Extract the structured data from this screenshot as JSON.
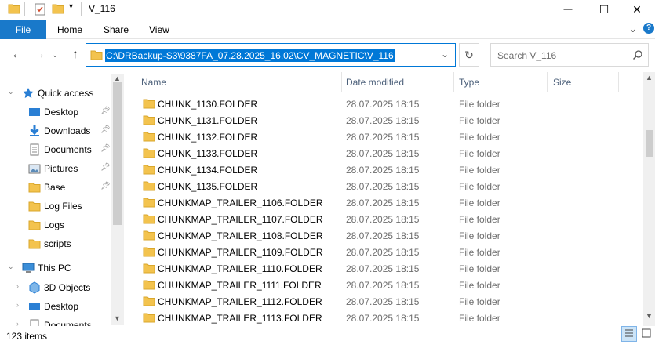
{
  "window": {
    "title": "V_116",
    "minimize_glyph": "—",
    "maximize_glyph": "☐",
    "close_glyph": "✕"
  },
  "ribbon": {
    "tabs": [
      "File",
      "Home",
      "Share",
      "View"
    ],
    "expand_glyph": "⌄",
    "help_glyph": "?"
  },
  "address": {
    "path": "C:\\DRBackup-S3\\9387FA_07.28.2025_16.02\\CV_MAGNETIC\\V_116",
    "search_placeholder": "Search V_116"
  },
  "nav": {
    "quick_access": "Quick access",
    "items": [
      {
        "label": "Desktop",
        "icon": "desktop-icon",
        "pinned": true
      },
      {
        "label": "Downloads",
        "icon": "downloads-icon",
        "pinned": true
      },
      {
        "label": "Documents",
        "icon": "documents-icon",
        "pinned": true
      },
      {
        "label": "Pictures",
        "icon": "pictures-icon",
        "pinned": true
      },
      {
        "label": "Base",
        "icon": "folder-icon",
        "pinned": true
      },
      {
        "label": "Log Files",
        "icon": "folder-icon",
        "pinned": false
      },
      {
        "label": "Logs",
        "icon": "folder-icon",
        "pinned": false
      },
      {
        "label": "scripts",
        "icon": "folder-icon",
        "pinned": false
      }
    ],
    "this_pc": "This PC",
    "pc_items": [
      {
        "label": "3D Objects",
        "icon": "3d-objects-icon"
      },
      {
        "label": "Desktop",
        "icon": "desktop-icon"
      },
      {
        "label": "Documents",
        "icon": "documents-icon"
      }
    ]
  },
  "columns": {
    "name": "Name",
    "date": "Date modified",
    "type": "Type",
    "size": "Size"
  },
  "files": [
    {
      "name": "CHUNK_1130.FOLDER",
      "date": "28.07.2025 18:15",
      "type": "File folder"
    },
    {
      "name": "CHUNK_1131.FOLDER",
      "date": "28.07.2025 18:15",
      "type": "File folder"
    },
    {
      "name": "CHUNK_1132.FOLDER",
      "date": "28.07.2025 18:15",
      "type": "File folder"
    },
    {
      "name": "CHUNK_1133.FOLDER",
      "date": "28.07.2025 18:15",
      "type": "File folder"
    },
    {
      "name": "CHUNK_1134.FOLDER",
      "date": "28.07.2025 18:15",
      "type": "File folder"
    },
    {
      "name": "CHUNK_1135.FOLDER",
      "date": "28.07.2025 18:15",
      "type": "File folder"
    },
    {
      "name": "CHUNKMAP_TRAILER_1106.FOLDER",
      "date": "28.07.2025 18:15",
      "type": "File folder"
    },
    {
      "name": "CHUNKMAP_TRAILER_1107.FOLDER",
      "date": "28.07.2025 18:15",
      "type": "File folder"
    },
    {
      "name": "CHUNKMAP_TRAILER_1108.FOLDER",
      "date": "28.07.2025 18:15",
      "type": "File folder"
    },
    {
      "name": "CHUNKMAP_TRAILER_1109.FOLDER",
      "date": "28.07.2025 18:15",
      "type": "File folder"
    },
    {
      "name": "CHUNKMAP_TRAILER_1110.FOLDER",
      "date": "28.07.2025 18:15",
      "type": "File folder"
    },
    {
      "name": "CHUNKMAP_TRAILER_1111.FOLDER",
      "date": "28.07.2025 18:15",
      "type": "File folder"
    },
    {
      "name": "CHUNKMAP_TRAILER_1112.FOLDER",
      "date": "28.07.2025 18:15",
      "type": "File folder"
    },
    {
      "name": "CHUNKMAP_TRAILER_1113.FOLDER",
      "date": "28.07.2025 18:15",
      "type": "File folder"
    }
  ],
  "status": {
    "item_count": "123 items"
  },
  "colors": {
    "accent": "#0078d7",
    "file_tab": "#1979ca",
    "folder": "#f3c34e",
    "header_text": "#4c607a"
  }
}
